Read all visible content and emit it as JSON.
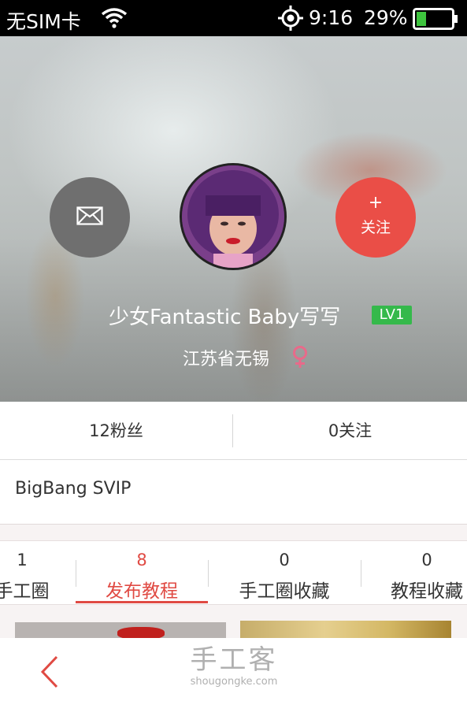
{
  "status_bar": {
    "carrier": "无SIM卡",
    "time": "9:16",
    "battery_percent": "29%",
    "battery_level": 0.29
  },
  "profile": {
    "message_icon": "mail-icon",
    "follow_plus": "+",
    "follow_label": "关注",
    "username": "少女Fantastic Baby写写",
    "level_badge": "LV1",
    "location": "江苏省无锡",
    "gender_icon": "female-icon"
  },
  "stats": {
    "fans": "12粉丝",
    "following": "0关注"
  },
  "vip": {
    "label": "BigBang SVIP"
  },
  "tabs": [
    {
      "count": "1",
      "label": "手工圈",
      "active": false
    },
    {
      "count": "8",
      "label": "发布教程",
      "active": true
    },
    {
      "count": "0",
      "label": "手工圈收藏",
      "active": false
    },
    {
      "count": "0",
      "label": "教程收藏",
      "active": false
    }
  ],
  "bottom_bar": {
    "back_icon": "chevron-left-icon",
    "watermark_cn": "手工客",
    "watermark_en": "shougongke.com"
  },
  "colors": {
    "accent": "#e04a43",
    "follow_button": "#ea4e47",
    "level_badge": "#35b94b",
    "gender_pink": "#e86a8a"
  }
}
